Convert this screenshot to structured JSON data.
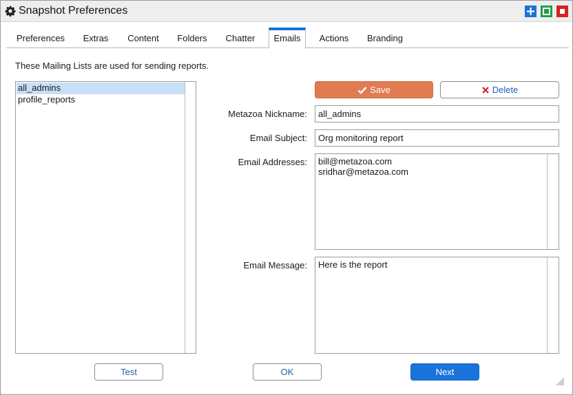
{
  "window": {
    "title": "Snapshot Preferences"
  },
  "tabs": [
    {
      "label": "Preferences",
      "active": false
    },
    {
      "label": "Extras",
      "active": false
    },
    {
      "label": "Content",
      "active": false
    },
    {
      "label": "Folders",
      "active": false
    },
    {
      "label": "Chatter",
      "active": false
    },
    {
      "label": "Emails",
      "active": true
    },
    {
      "label": "Actions",
      "active": false
    },
    {
      "label": "Branding",
      "active": false
    }
  ],
  "intro_text": "These Mailing Lists are used for sending reports.",
  "mailing_lists": [
    {
      "name": "all_admins",
      "selected": true
    },
    {
      "name": "profile_reports",
      "selected": false
    }
  ],
  "actions": {
    "save_label": "Save",
    "delete_label": "Delete"
  },
  "form": {
    "nickname_label": "Metazoa Nickname:",
    "nickname_value": "all_admins",
    "subject_label": "Email Subject:",
    "subject_value": "Org monitoring report",
    "addresses_label": "Email Addresses:",
    "addresses": [
      "bill@metazoa.com",
      "sridhar@metazoa.com"
    ],
    "message_label": "Email Message:",
    "message_value": "Here is the report"
  },
  "footer": {
    "test_label": "Test",
    "ok_label": "OK",
    "next_label": "Next"
  },
  "colors": {
    "accent": "#1a73d9",
    "save": "#e07b52",
    "maximize": "#1f9d4a",
    "close": "#d42222",
    "selection": "#c7e0f8"
  },
  "icons": {
    "title": "gear-icon",
    "save": "checkmark-icon",
    "delete": "x-icon"
  }
}
